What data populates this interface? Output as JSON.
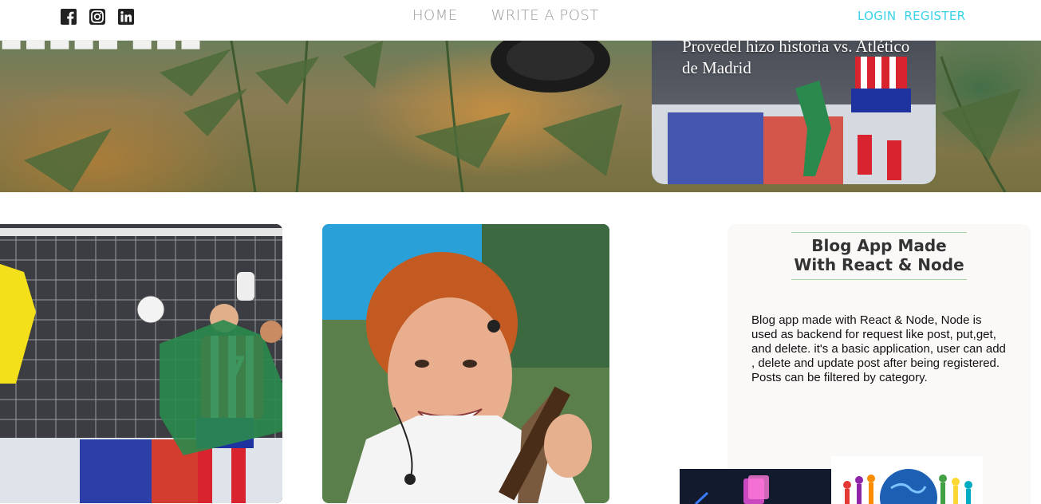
{
  "nav": {
    "social": [
      {
        "icon": "facebook-icon"
      },
      {
        "icon": "instagram-icon"
      },
      {
        "icon": "linkedin-icon"
      }
    ],
    "links": [
      "HOME",
      "WRITE A POST"
    ],
    "auth": {
      "login": "LOGIN",
      "register": "REGISTER"
    }
  },
  "banner": {
    "featured_title": "Provedel hizo historia vs. Atlético de Madrid"
  },
  "sidebar": {
    "title": "Blog App Made With React & Node",
    "description": "Blog app made with React & Node, Node is used as backend for request like post, put,get, and delete. it's a basic application, user can add , delete and update post after being registered. Posts can be filtered by category."
  },
  "colors": {
    "nav_link": "#9a9a9a",
    "auth_link": "#39d3e8",
    "sidebar_bg": "#fbf8f8",
    "sidebar_rule": "#a5d6a7"
  }
}
